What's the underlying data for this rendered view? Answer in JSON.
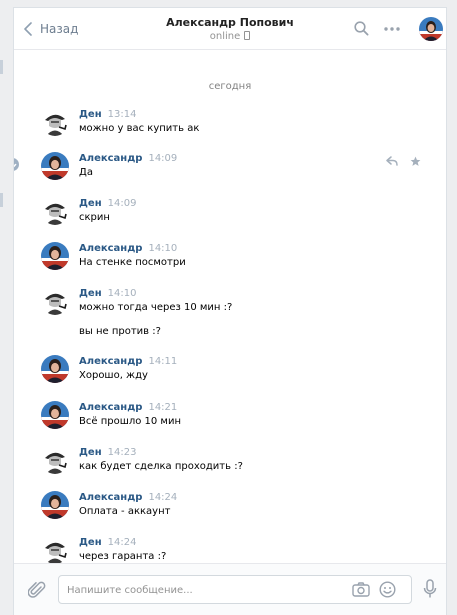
{
  "header": {
    "back_label": "Назад",
    "title": "Александр Попович",
    "status": "online"
  },
  "date_separator": "сегодня",
  "messages": [
    {
      "name": "Ден",
      "time": "13:14",
      "lines": [
        "можно у вас купить ак"
      ]
    },
    {
      "name": "Александр",
      "time": "14:09",
      "lines": [
        "Да"
      ]
    },
    {
      "name": "Ден",
      "time": "14:09",
      "lines": [
        "скрин"
      ]
    },
    {
      "name": "Александр",
      "time": "14:10",
      "lines": [
        "На стенке посмотри"
      ]
    },
    {
      "name": "Ден",
      "time": "14:10",
      "lines": [
        "можно тогда через 10 мин :?",
        "вы не против :?"
      ]
    },
    {
      "name": "Александр",
      "time": "14:11",
      "lines": [
        "Хорошо, жду"
      ]
    },
    {
      "name": "Александр",
      "time": "14:21",
      "lines": [
        "Всё прошло 10 мин"
      ]
    },
    {
      "name": "Ден",
      "time": "14:23",
      "lines": [
        "как будет сделка проходить :?"
      ]
    },
    {
      "name": "Александр",
      "time": "14:24",
      "lines": [
        "Оплата - аккаунт"
      ]
    },
    {
      "name": "Ден",
      "time": "14:24",
      "lines": [
        "через гаранта :?"
      ]
    }
  ],
  "composer": {
    "placeholder": "Напишите сообщение..."
  },
  "icons": {
    "back": "chevron-left-icon",
    "search": "search-icon",
    "more": "more-dots-icon",
    "reply": "reply-icon",
    "star": "star-icon",
    "attach": "paperclip-icon",
    "camera": "camera-icon",
    "emoji": "smile-icon",
    "mic": "microphone-icon"
  },
  "colors": {
    "link": "#2a5885",
    "time": "#a5b0bc",
    "background": "#edeef0"
  }
}
